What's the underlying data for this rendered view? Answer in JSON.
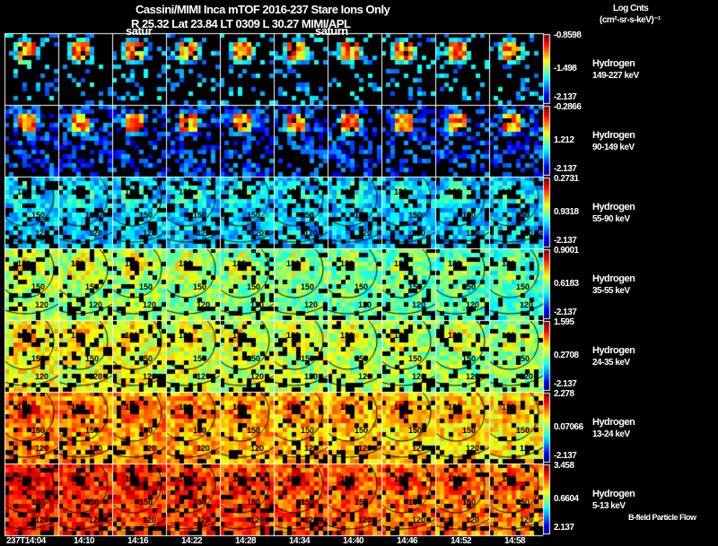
{
  "header": {
    "title": "Cassini/MIMI Inca mTOF  2016-237    Stare    Ions Only",
    "subtitle": "R        25.32 Lat 23.84 LT 0309 L          30.27  MIMI/APL",
    "overlay_left": "satur",
    "overlay_right": "saturn"
  },
  "units": {
    "line1": "Log Cnts",
    "line2": "(cm²-sr-s-keV)⁻¹"
  },
  "footer_label": "B-field Particle Flow",
  "chart_data": {
    "type": "heatmap",
    "title": "Cassini/MIMI Inca mTOF 2016-237 Stare Ions Only",
    "times": [
      "237T14:04",
      "14:10",
      "14:16",
      "14:22",
      "14:28",
      "14:34",
      "14:40",
      "14:46",
      "14:52",
      "14:58"
    ],
    "contour_labels": [
      "180",
      "150",
      "120"
    ],
    "rows": [
      {
        "species": "Hydrogen",
        "energy": "149-227 keV",
        "cmax": "-0.8598",
        "cmid": "-1.498",
        "cmin": "-2.137"
      },
      {
        "species": "Hydrogen",
        "energy": "90-149 keV",
        "cmax": "-0.2866",
        "cmid": "1.212",
        "cmin": "-2.137"
      },
      {
        "species": "Hydrogen",
        "energy": "55-90 keV",
        "cmax": "0.2731",
        "cmid": "0.9318",
        "cmin": "-2.137"
      },
      {
        "species": "Hydrogen",
        "energy": "35-55 keV",
        "cmax": "0.9001",
        "cmid": "0.6183",
        "cmin": "-2.137"
      },
      {
        "species": "Hydrogen",
        "energy": "24-35 keV",
        "cmax": "1.595",
        "cmid": "0.2708",
        "cmin": "-2.137"
      },
      {
        "species": "Hydrogen",
        "energy": "13-24 keV",
        "cmax": "2.278",
        "cmid": "0.07066",
        "cmin": "-2.137"
      },
      {
        "species": "Hydrogen",
        "energy": "5-13 keV",
        "cmax": "3.458",
        "cmid": "0.6604",
        "cmin": "2.137"
      }
    ],
    "colormap": "jet"
  }
}
